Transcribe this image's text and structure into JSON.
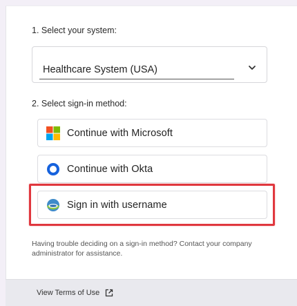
{
  "step1": {
    "label": "1. Select your system:"
  },
  "system_select": {
    "value": "Healthcare System (USA)",
    "icon": "chevron-down-icon"
  },
  "step2": {
    "label": "2. Select sign-in method:"
  },
  "methods": [
    {
      "label": "Continue with Microsoft",
      "icon": "microsoft-logo-icon"
    },
    {
      "label": "Continue with Okta",
      "icon": "okta-logo-icon"
    },
    {
      "label": "Sign in with username",
      "icon": "username-logo-icon"
    }
  ],
  "help_text": "Having trouble deciding on a sign-in method? Contact your company administrator for assistance.",
  "footer": {
    "terms_label": "View Terms of Use",
    "icon": "external-link-icon"
  },
  "colors": {
    "highlight": "#e0373e",
    "ms_red": "#f25022",
    "ms_green": "#7fba00",
    "ms_blue": "#00a4ef",
    "ms_yellow": "#ffb900",
    "okta_blue": "#1662dd"
  }
}
